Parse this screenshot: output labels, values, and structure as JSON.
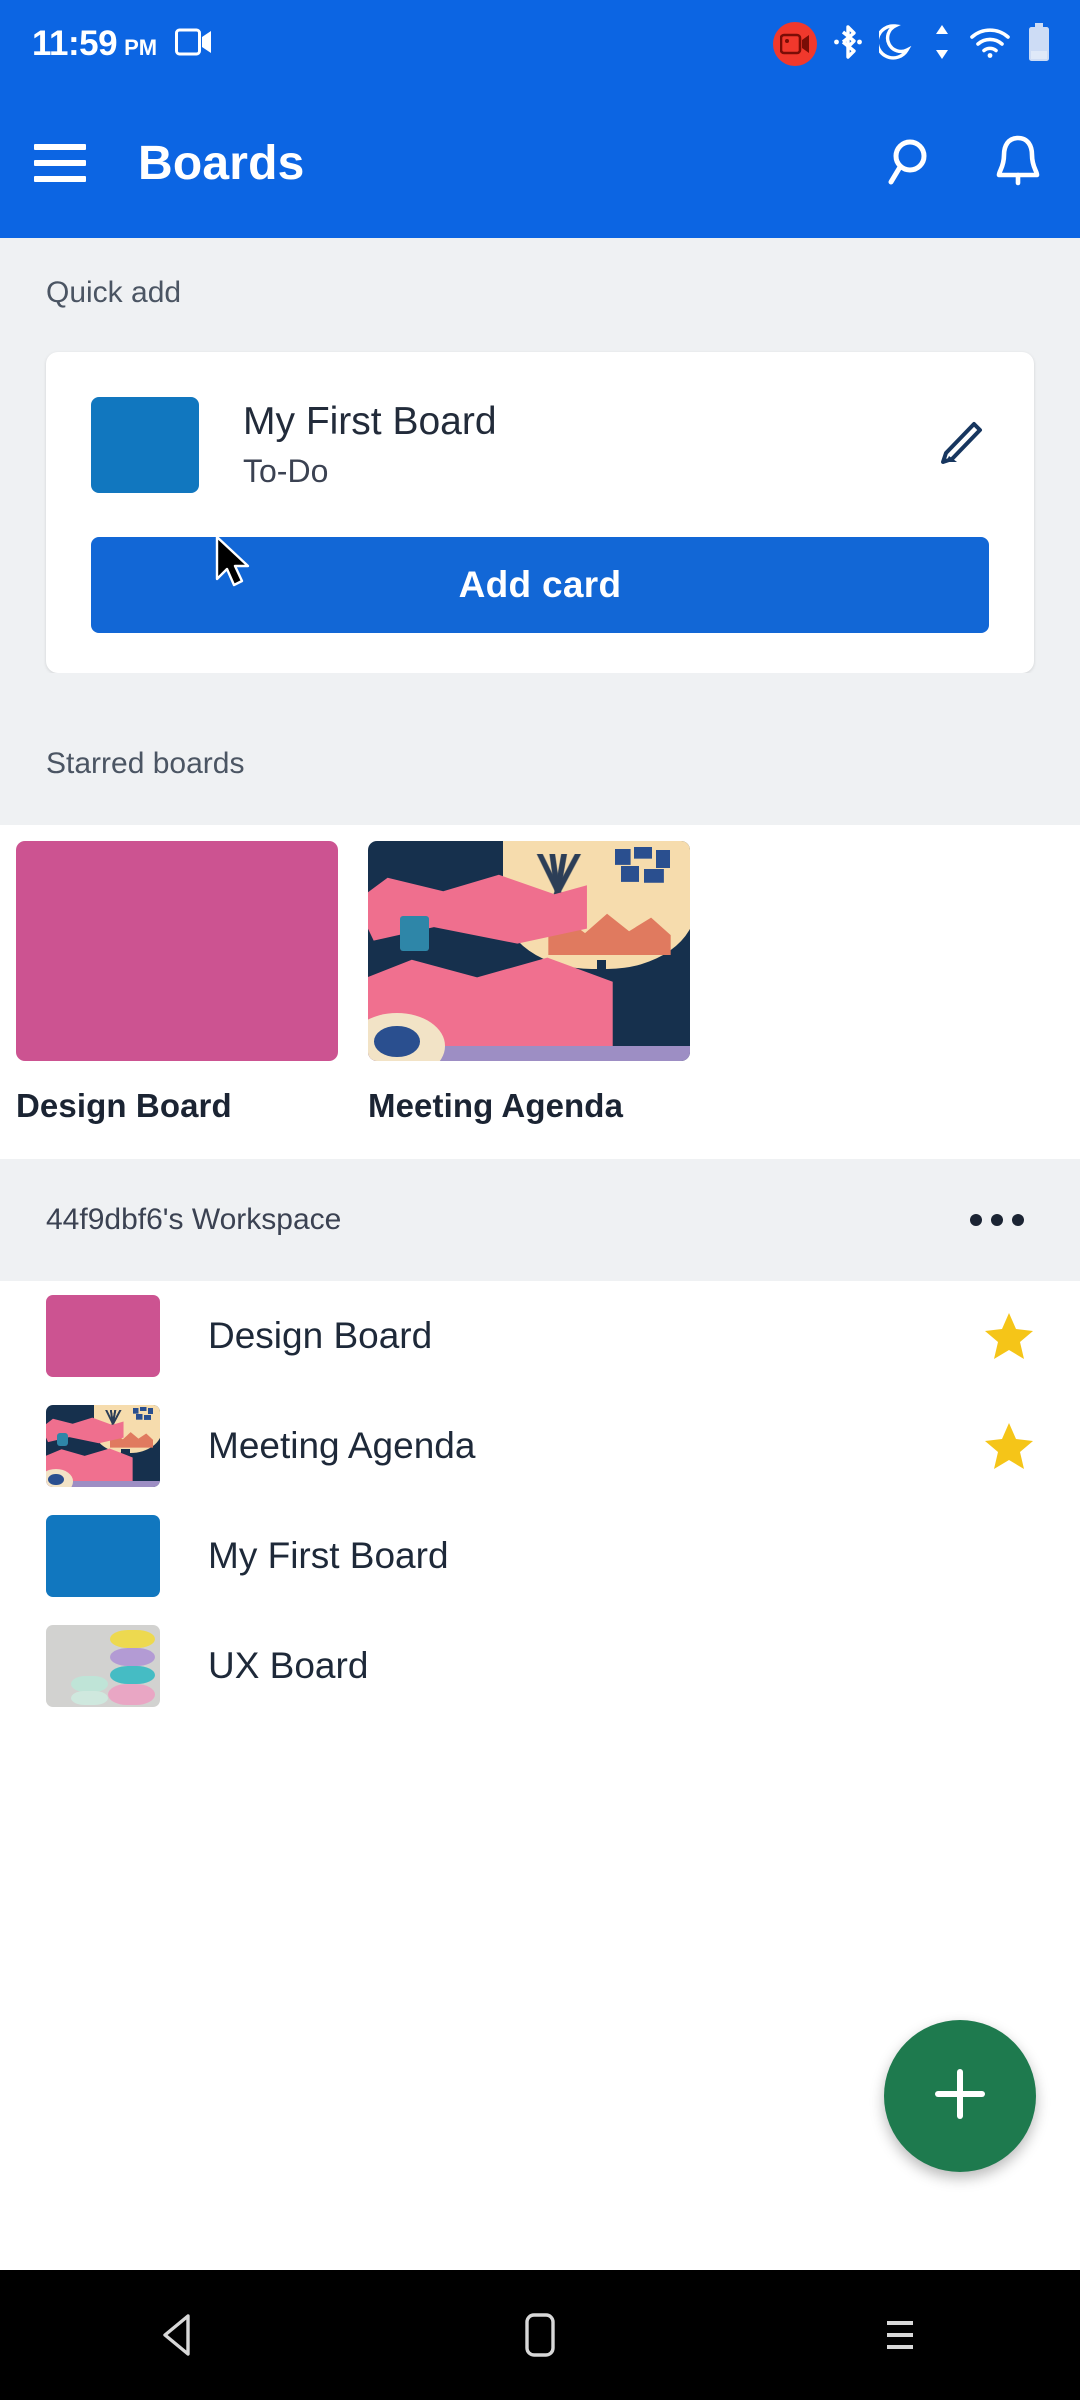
{
  "status_bar": {
    "time": "11:59",
    "meridiem": "PM",
    "icons": {
      "screen_cast": "screen-cast-icon",
      "recording": "screen-recording-icon",
      "bluetooth": "bluetooth-icon",
      "do_not_disturb": "moon-icon",
      "data_transfer": "data-transfer-arrows-icon",
      "wifi": "wifi-icon",
      "battery": "battery-icon"
    },
    "recording_badge_color": "#f1382c",
    "background_color": "#0c65e3"
  },
  "app_bar": {
    "title": "Boards",
    "menu_icon": "hamburger-menu-icon",
    "search_icon": "search-icon",
    "notifications_icon": "bell-icon",
    "background_color": "#0c65e3"
  },
  "quick_add": {
    "section_label": "Quick add",
    "board_name": "My First Board",
    "list_name": "To-Do",
    "thumb_color": "#1177bf",
    "edit_icon": "pencil-icon",
    "button_label": "Add card",
    "button_color": "#1267d6"
  },
  "starred": {
    "section_label": "Starred boards",
    "tiles": [
      {
        "name": "Design Board",
        "art": "solid-pink",
        "color": "#cc5391"
      },
      {
        "name": "Meeting Agenda",
        "art": "meeting-photo",
        "color": "#16304d"
      }
    ]
  },
  "workspace": {
    "name": "44f9dbf6's Workspace",
    "overflow_icon": "more-options-icon",
    "boards": [
      {
        "name": "Design Board",
        "art": "solid-pink",
        "starred": true
      },
      {
        "name": "Meeting Agenda",
        "art": "meeting-photo",
        "starred": true
      },
      {
        "name": "My First Board",
        "art": "solid-blue",
        "starred": false
      },
      {
        "name": "UX Board",
        "art": "macaron-photo",
        "starred": false
      }
    ],
    "star_color": "#f5c518"
  },
  "fab": {
    "icon": "plus-icon",
    "color": "#1e7a4e"
  },
  "nav_bar": {
    "back": "back-triangle-icon",
    "home": "home-square-icon",
    "recents": "recents-lines-icon"
  },
  "cursor": {
    "icon": "mouse-pointer-icon"
  }
}
